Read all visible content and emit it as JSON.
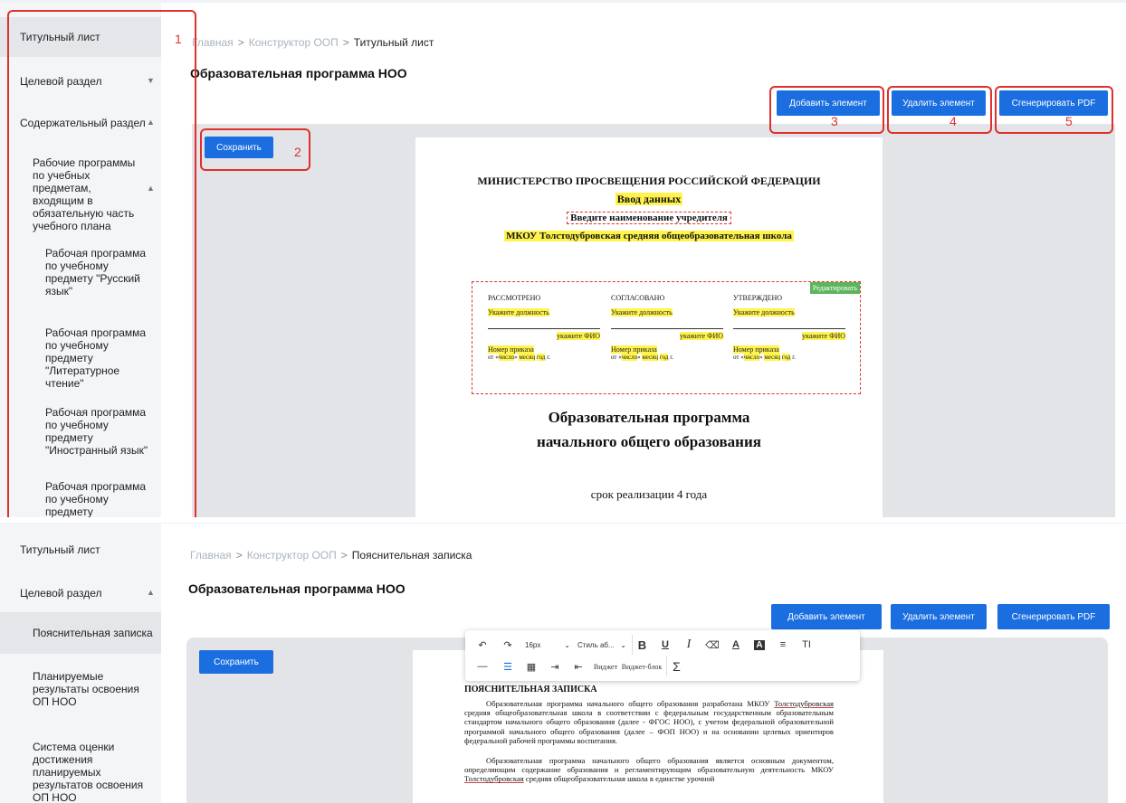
{
  "panel1": {
    "sidebar": {
      "title_page": "Титульный лист",
      "target_section": "Целевой раздел",
      "content_section": "Содержательный раздел",
      "work_programs": "Рабочие программы по учебных предметам, входящим в обязательную часть учебного плана",
      "rp_russian": "Рабочая программа по учебному предмету \"Русский язык\"",
      "rp_literature": "Рабочая программа по учебному предмету \"Литературное чтение\"",
      "rp_foreign": "Рабочая программа по учебному предмету \"Иностранный язык\"",
      "rp_cut": "Рабочая программа по учебному предмету"
    },
    "breadcrumb": {
      "home": "Главная",
      "constructor": "Конструктор ООП",
      "current": "Титульный лист",
      "sep": ">"
    },
    "page_title": "Образовательная программа НОО",
    "buttons": {
      "add": "Добавить элемент",
      "delete": "Удалить элемент",
      "pdf": "Сгенерировать PDF",
      "save": "Сохранить"
    },
    "annotations": {
      "n1": "1",
      "n2": "2",
      "n3": "3",
      "n4": "4",
      "n5": "5"
    },
    "doc": {
      "ministry": "МИНИСТЕРСТВО ПРОСВЕЩЕНИЯ РОССИЙСКОЙ ФЕДЕРАЦИИ",
      "data_input": "Ввод данных",
      "founder": "Введите наименование учредителя",
      "school": "МКОУ Толстодубровская средняя общеобразовательная школа",
      "edit": "Редактировать",
      "col1_head": "РАССМОТРЕНО",
      "col2_head": "СОГЛАСОВАНО",
      "col3_head": "УТВЕРЖДЕНО",
      "position": "Укажите должность",
      "fio": "укажите ФИО",
      "order": "Номер приказа",
      "from": "от «",
      "number": "число",
      "close_quote": "» ",
      "month": "месяц",
      "year": "год",
      "yr_suffix": " г.",
      "title1": "Образовательная программа",
      "title2": "начального общего образования",
      "term": "срок реализации 4 года"
    }
  },
  "panel2": {
    "sidebar": {
      "title_page": "Титульный лист",
      "target_section": "Целевой раздел",
      "explanatory": "Пояснительная записка",
      "planned": "Планируемые результаты освоения ОП НОО",
      "assessment": "Система оценки достижения планируемых результатов освоения ОП НОО"
    },
    "breadcrumb": {
      "home": "Главная",
      "constructor": "Конструктор ООП",
      "current": "Пояснительная записка",
      "sep": ">"
    },
    "page_title": "Образовательная программа НОО",
    "buttons": {
      "add": "Добавить элемент",
      "delete": "Удалить элемент",
      "pdf": "Сгенерировать PDF",
      "save": "Сохранить"
    },
    "toolbar": {
      "font_size": "16px",
      "style": "Стиль аб...",
      "bold": "B",
      "underline": "U",
      "italic": "I",
      "clear": "⌫",
      "color": "A",
      "bg": "A",
      "align": "≡",
      "size": "TI",
      "hr": "—",
      "list": "☰",
      "table": "▦",
      "indent": "⇥",
      "outdent": "⇤",
      "widget": "Виджет",
      "widget_block": "Виджет-блок",
      "sigma": "Σ"
    },
    "doc": {
      "heading": "ПОЯСНИТЕЛЬНАЯ ЗАПИСКА",
      "p1_a": "Образовательная программа начального общего образования разработана МКОУ",
      "p1_school": "Толстодубровская",
      "p1_b": " средняя общеобразовательная школа в соответствии с федеральным государственным образовательным стандартом начального общего образования (далее - ФГОС НОО), с учетом федеральной образовательной программой начального общего образования (далее – ФОП НОО) и на основании целевых ориентиров федеральной рабочей программы воспитания.",
      "p2_a": "Образовательная программа начального общего образования является основным документом, определяющим содержание образования и регламентирующим образовательную деятельность МКОУ ",
      "p2_school": "Толстодубровская",
      "p2_b": " средняя общеобразовательная школа в единстве урочной"
    }
  }
}
